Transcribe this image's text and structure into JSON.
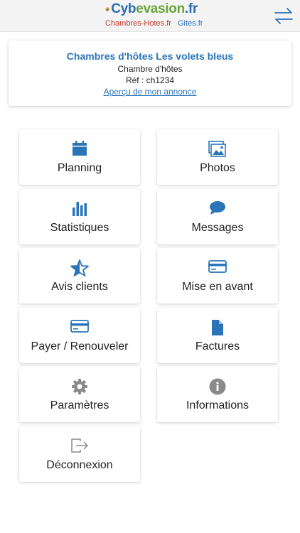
{
  "header": {
    "logo_main_prefix": "Cyb",
    "logo_main_accent": "evasion",
    "logo_main_suffix": ".fr",
    "logo_sub_1": "Chambres-Hotes.fr",
    "logo_sub_2": "Gites.fr",
    "switch_icon": "swap-arrows-icon"
  },
  "listing": {
    "title": "Chambres d'hôtes Les volets bleus",
    "type": "Chambre d'hôtes",
    "ref": "Réf : ch1234",
    "preview_link": "Aperçu de mon annonce"
  },
  "menu": [
    {
      "label": "Planning",
      "icon": "calendar-icon"
    },
    {
      "label": "Photos",
      "icon": "photos-icon"
    },
    {
      "label": "Statistiques",
      "icon": "bar-chart-icon"
    },
    {
      "label": "Messages",
      "icon": "chat-bubble-icon"
    },
    {
      "label": "Avis clients",
      "icon": "star-icon"
    },
    {
      "label": "Mise en avant",
      "icon": "credit-card-icon"
    },
    {
      "label": "Payer / Renouveler",
      "icon": "credit-card-icon"
    },
    {
      "label": "Factures",
      "icon": "document-icon"
    },
    {
      "label": "Paramètres",
      "icon": "gear-icon"
    },
    {
      "label": "Informations",
      "icon": "info-icon"
    },
    {
      "label": "Déconnexion",
      "icon": "logout-icon"
    }
  ],
  "colors": {
    "accent_blue": "#2a74b8",
    "icon_grey": "#8a8a8a"
  }
}
